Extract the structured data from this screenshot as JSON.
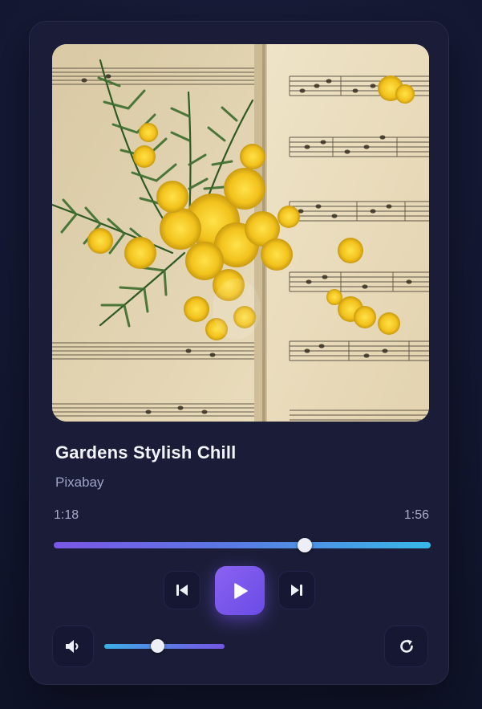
{
  "track": {
    "title": "Gardens Stylish Chill",
    "artist": "Pixabay",
    "current_time": "1:18",
    "total_time": "1:56",
    "progress_fraction": 0.665
  },
  "volume": {
    "level_fraction": 0.44
  },
  "icons": {
    "previous": "skip-previous-icon",
    "play": "play-icon",
    "next": "skip-next-icon",
    "volume": "volume-icon",
    "repeat": "repeat-icon"
  },
  "colors": {
    "accent_purple": "#7b56e6",
    "accent_cyan": "#38b8e8",
    "card_background": "#1b1d38",
    "page_background": "#141833"
  }
}
